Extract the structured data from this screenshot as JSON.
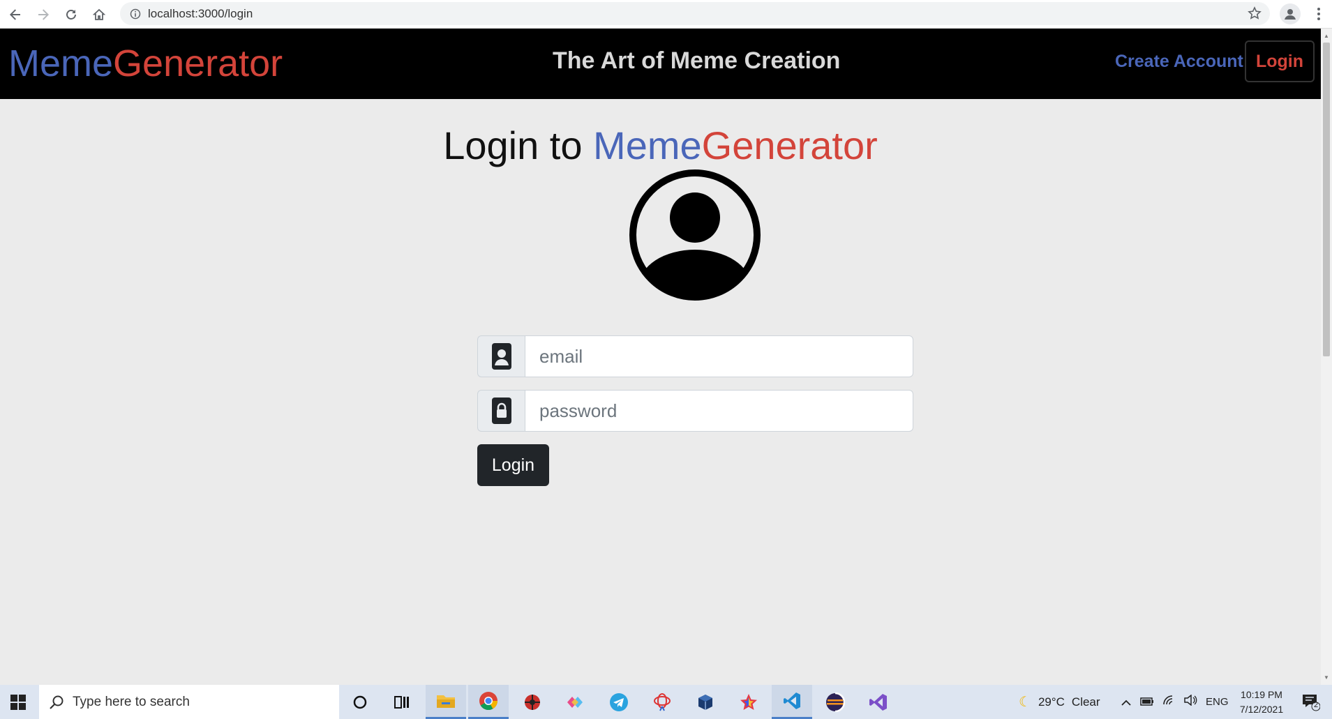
{
  "browser": {
    "url": "localhost:3000/login"
  },
  "navbar": {
    "brand_part1": "Meme",
    "brand_part2": "Generator",
    "tagline": "The Art of Meme Creation",
    "create_account": "Create Account",
    "login": "Login"
  },
  "main": {
    "heading_prefix": "Login to ",
    "heading_brand1": "Meme",
    "heading_brand2": "Generator",
    "email_placeholder": "email",
    "password_placeholder": "password",
    "login_button": "Login"
  },
  "taskbar": {
    "search_placeholder": "Type here to search",
    "weather_temp": "29°C",
    "weather_cond": "Clear",
    "language": "ENG",
    "time": "10:19 PM",
    "date": "7/12/2021",
    "notification_count": "2"
  },
  "colors": {
    "brand_blue": "#4a66b9",
    "brand_red": "#d3443a",
    "navbar_bg": "#000000",
    "page_bg": "#ebebeb"
  }
}
